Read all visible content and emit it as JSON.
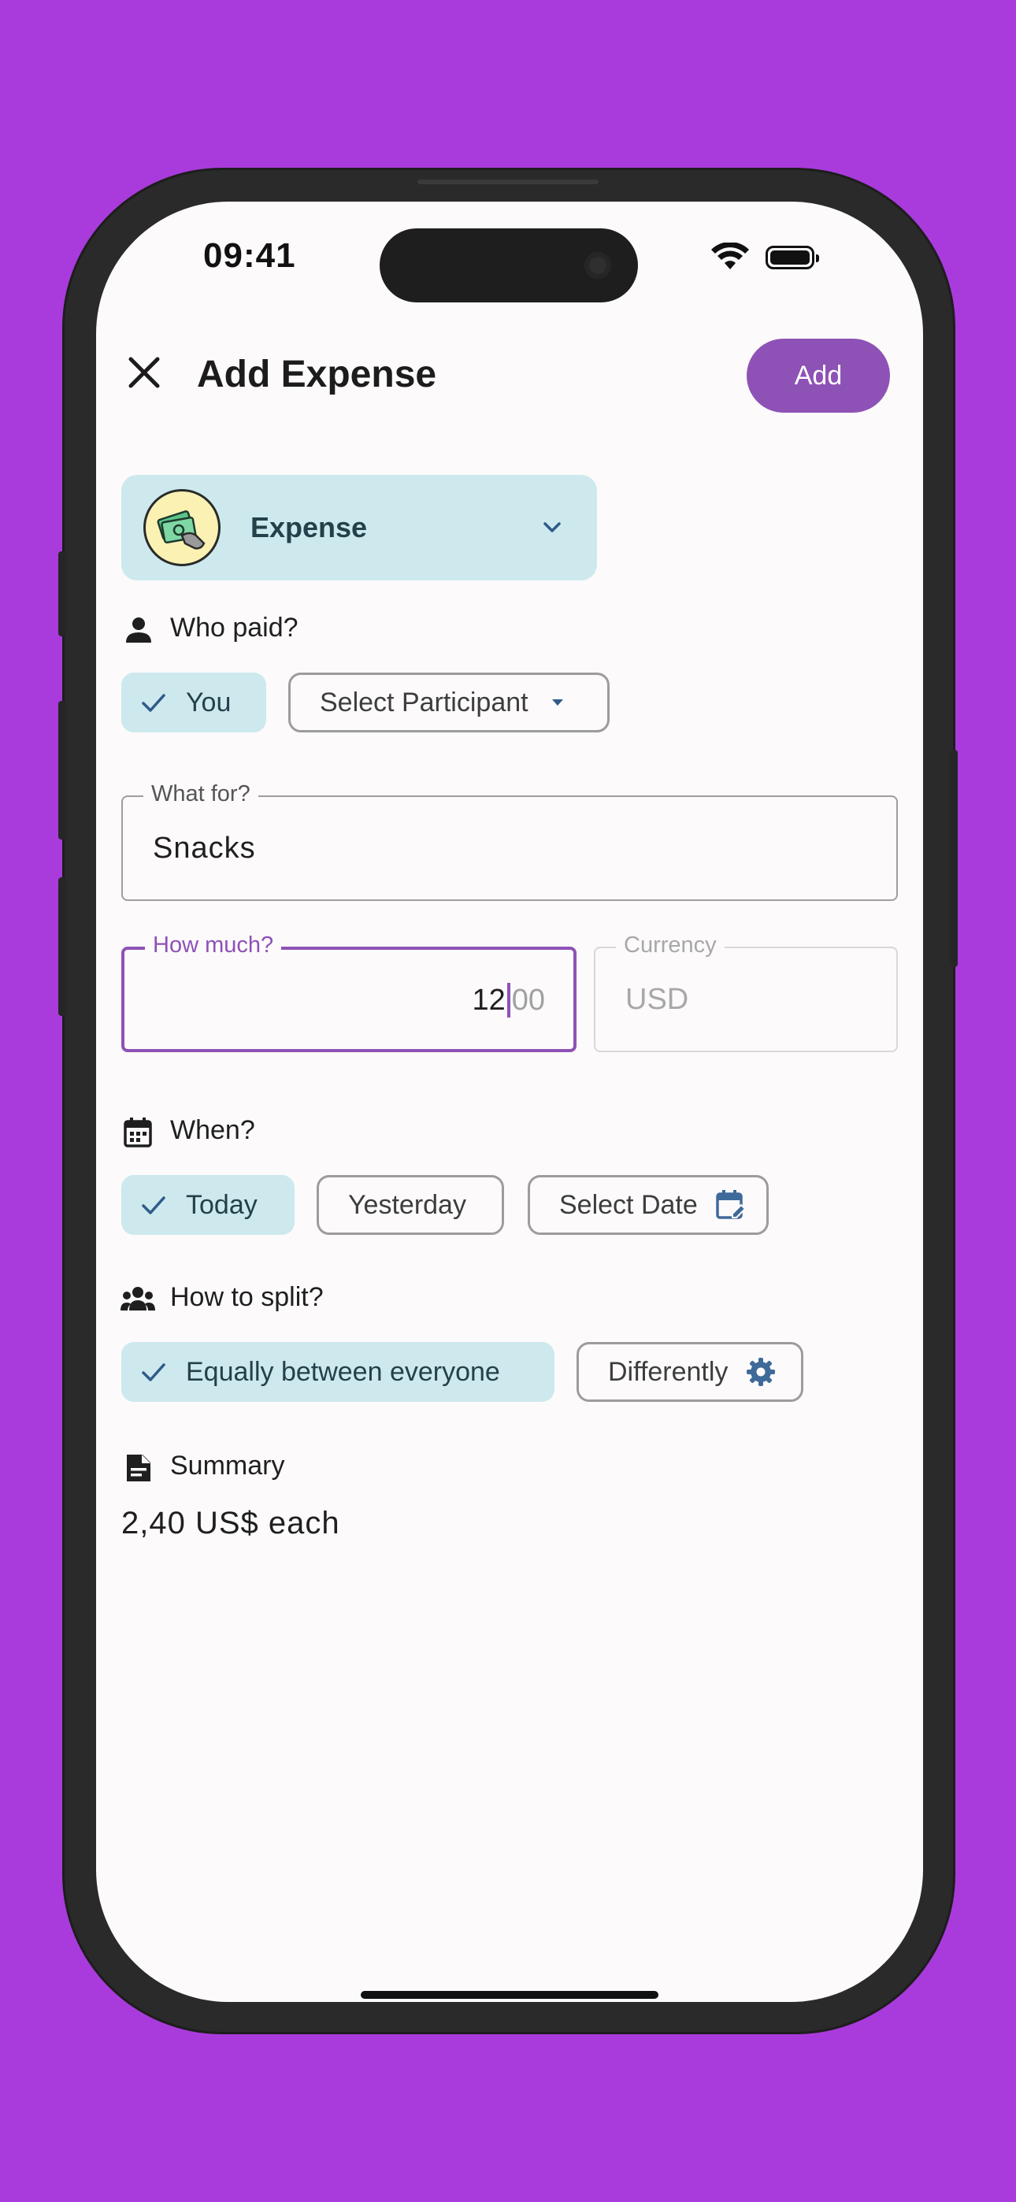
{
  "status_bar": {
    "time": "09:41"
  },
  "header": {
    "title": "Add Expense",
    "add_label": "Add"
  },
  "type_selector": {
    "label": "Expense",
    "icon": "money-hand-icon"
  },
  "who_paid": {
    "label": "Who paid?",
    "selected_chip": "You",
    "dropdown_label": "Select Participant"
  },
  "what_for": {
    "legend": "What for?",
    "value": "Snacks"
  },
  "how_much": {
    "legend": "How much?",
    "value": "12",
    "placeholder_decimals": "00"
  },
  "currency": {
    "legend": "Currency",
    "value": "USD"
  },
  "when": {
    "label": "When?",
    "options": [
      "Today",
      "Yesterday",
      "Select Date"
    ],
    "selected": "Today"
  },
  "split": {
    "label": "How to split?",
    "selected_option": "Equally between everyone",
    "other_option": "Differently"
  },
  "summary": {
    "label": "Summary",
    "value": "2,40 US$ each"
  },
  "colors": {
    "background": "#a93bdc",
    "accent": "#8e52b6",
    "chip_selected": "#cde9ee",
    "icon_blue": "#3e6a99"
  }
}
